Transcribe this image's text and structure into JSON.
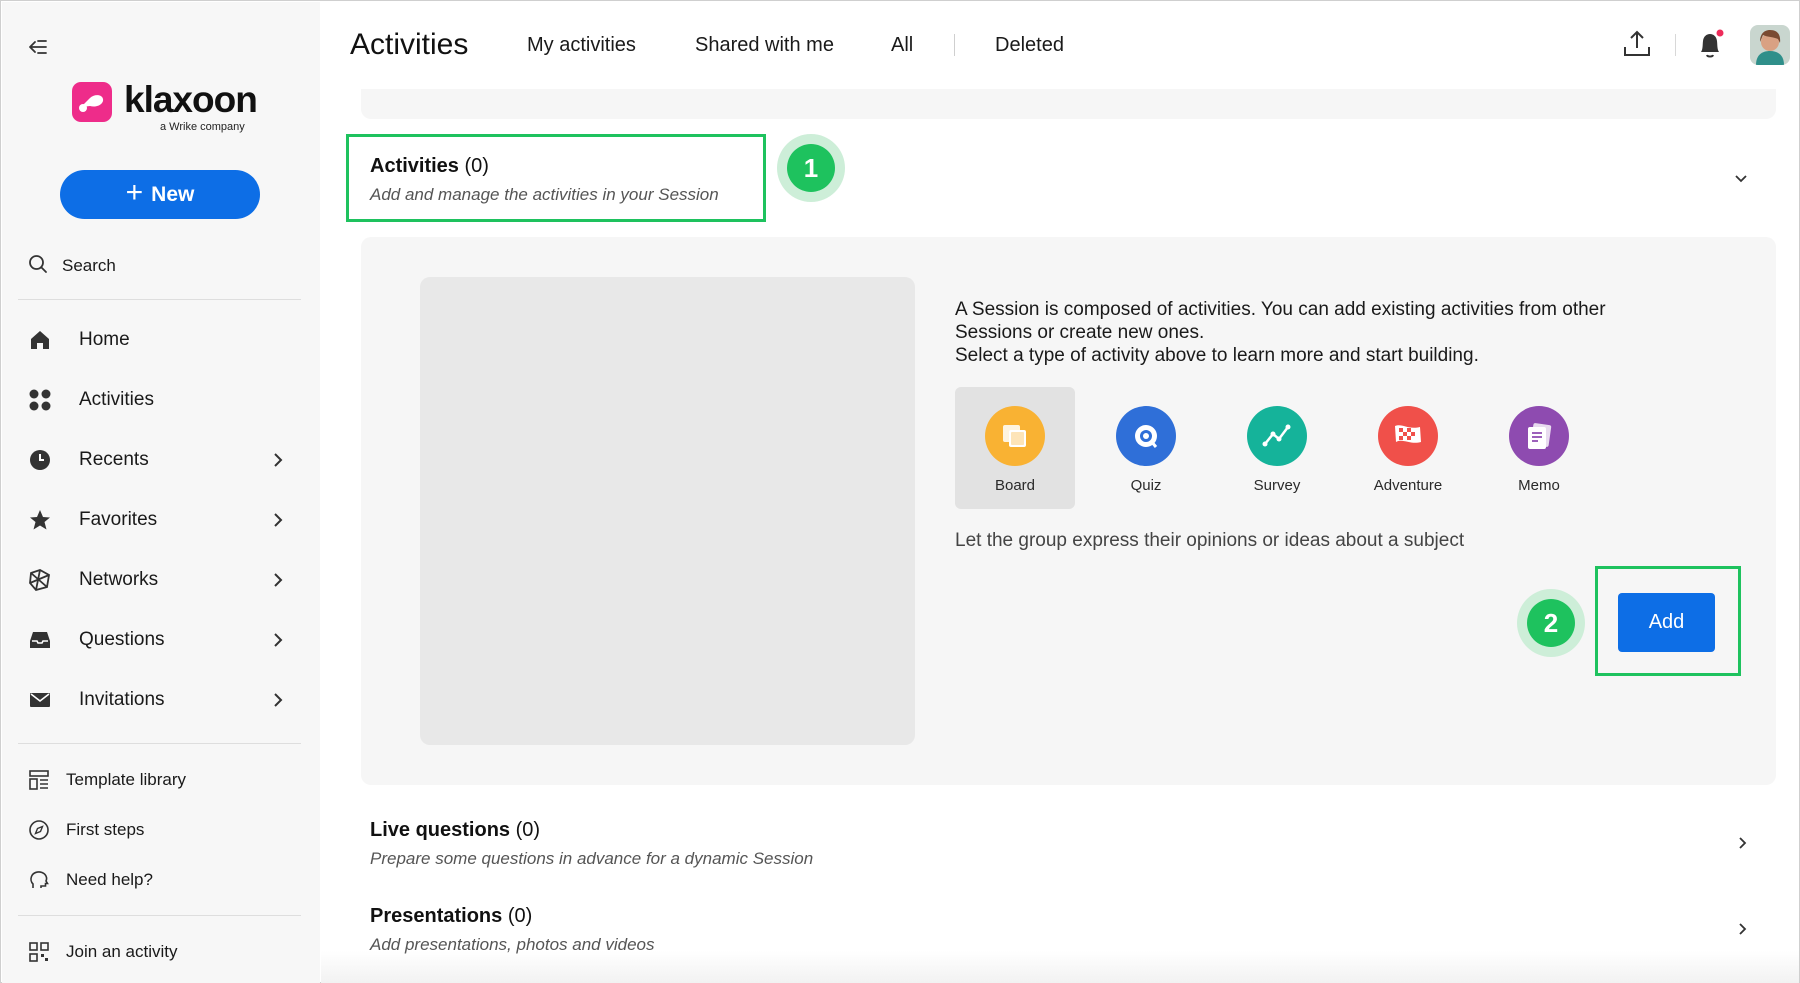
{
  "sidebar": {
    "logo": {
      "name": "klaxoon",
      "tagline": "a Wrike company"
    },
    "new_label": "New",
    "search_label": "Search",
    "nav": [
      {
        "label": "Home",
        "icon": "home-icon"
      },
      {
        "label": "Activities",
        "icon": "grid-dots-icon"
      },
      {
        "label": "Recents",
        "icon": "clock-icon"
      },
      {
        "label": "Favorites",
        "icon": "star-icon"
      },
      {
        "label": "Networks",
        "icon": "network-icon"
      },
      {
        "label": "Questions",
        "icon": "inbox-icon"
      },
      {
        "label": "Invitations",
        "icon": "envelope-icon"
      }
    ],
    "links": [
      {
        "label": "Template library",
        "icon": "template-icon"
      },
      {
        "label": "First steps",
        "icon": "compass-icon"
      },
      {
        "label": "Need help?",
        "icon": "help-head-icon"
      },
      {
        "label": "Join an activity",
        "icon": "qr-code-icon"
      }
    ]
  },
  "header": {
    "title": "Activities",
    "tabs": [
      "My activities",
      "Shared with me",
      "All",
      "Deleted"
    ]
  },
  "activities_section": {
    "title": "Activities",
    "count": "(0)",
    "subtitle": "Add and manage the activities in your Session",
    "step_badge": "1"
  },
  "panel": {
    "description": [
      "A Session is composed of activities. You can add existing activities from other",
      "Sessions or create new ones.",
      "Select a type of activity above to learn more and start building."
    ],
    "types": [
      {
        "label": "Board",
        "color": "#f9b233",
        "icon": "board-icon",
        "selected": true
      },
      {
        "label": "Quiz",
        "color": "#2f6fd8",
        "icon": "quiz-icon",
        "selected": false
      },
      {
        "label": "Survey",
        "color": "#15b39a",
        "icon": "survey-icon",
        "selected": false
      },
      {
        "label": "Adventure",
        "color": "#f0504a",
        "icon": "adventure-icon",
        "selected": false
      },
      {
        "label": "Memo",
        "color": "#8e4bb0",
        "icon": "memo-icon",
        "selected": false
      }
    ],
    "type_description": "Let the group express their opinions or ideas about a subject",
    "add_label": "Add",
    "step_badge": "2"
  },
  "sections": [
    {
      "title": "Live questions",
      "count": "(0)",
      "subtitle": "Prepare some questions in advance for a dynamic Session"
    },
    {
      "title": "Presentations",
      "count": "(0)",
      "subtitle": "Add presentations, photos and videos"
    }
  ],
  "colors": {
    "accent": "#0d6ee6",
    "highlight": "#1ec25e",
    "brand": "#ee2c8a"
  }
}
